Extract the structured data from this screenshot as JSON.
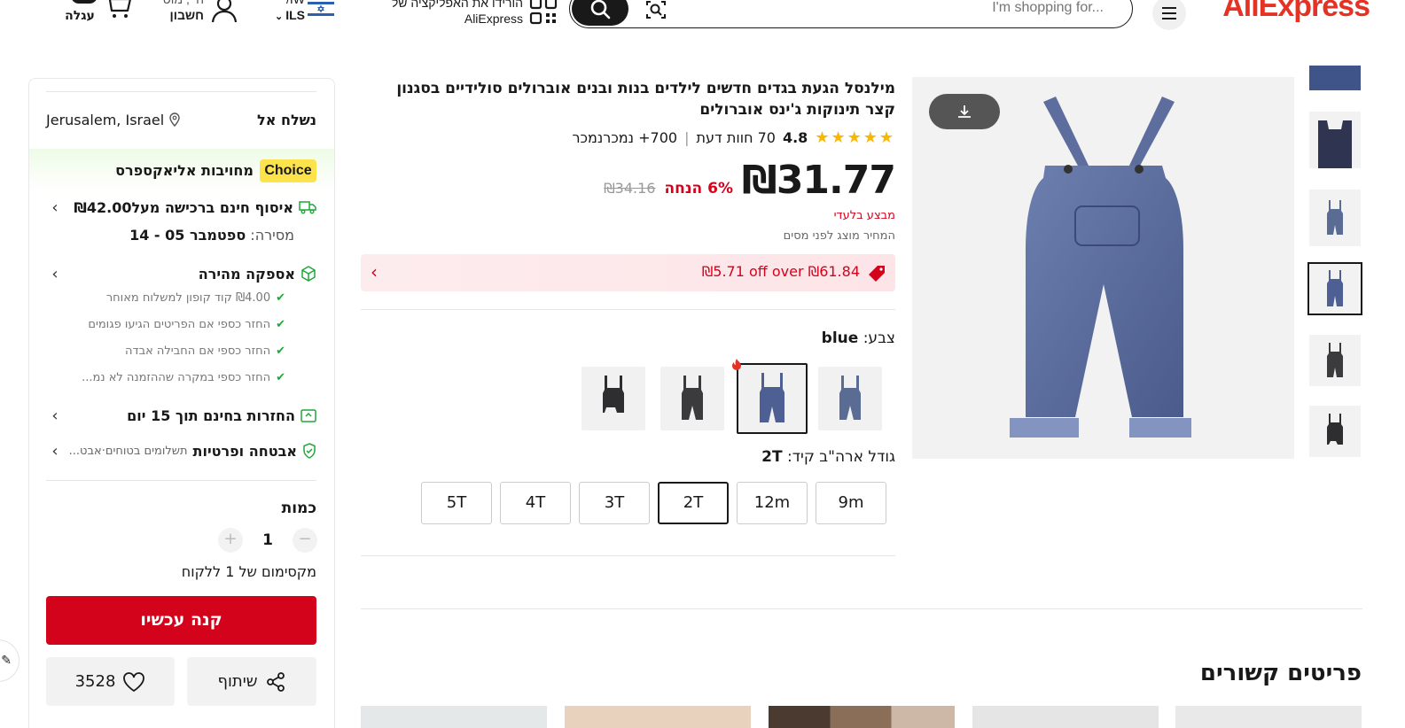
{
  "header": {
    "logo": "AliExpress",
    "search_placeholder": "I'm shopping for...",
    "app_line1": "הורידו את האפליקציה של",
    "app_line2": "AliExpress",
    "lang_line1": "/IW",
    "currency": "ILS",
    "account_line1": "היי, מוט",
    "account_line2": "חשבון",
    "cart_label": "עגלה"
  },
  "left_panel": {
    "ship_to_label": "נשלח אל",
    "location": "Jerusalem, Israel",
    "choice_badge": "Choice",
    "choice_text": "מחויבות אליאקספרס",
    "free_shipping": "איסוף חינם ברכישה מעל₪42.00",
    "delivery_label": "מסירה:",
    "delivery_dates": "ספטמבר 05 - 14",
    "fast_delivery": "אספקה מהירה",
    "checks": [
      "₪4.00 קוד קופון למשלוח מאוחר",
      "החזר כספי אם הפריטים הגיעו פגומים",
      "החזר כספי אם החבילה אבדה",
      "החזר כספי במקרה שההזמנה לא נמ..."
    ],
    "returns": "החזרות בחינם תוך 15 יום",
    "security_bold": "אבטחה ופרטיות",
    "security_rest": "תשלומים בטוחים·אבט...",
    "qty_title": "כמות",
    "qty_value": "1",
    "max_note": "מקסימום של 1 ללקוח",
    "buy_now": "קנה עכשיו",
    "share": "שיתוף",
    "wishlist_count": "3528"
  },
  "product": {
    "title": "מילנסל הגעת בגדים חדשים לילדים בנות ובנים אוברולים סולידיים בסגנון קצר תינוקות ג'ינס אוברולים",
    "rating": "4.8",
    "reviews": "70 חוות דעת",
    "sold": "700+ נמכרנמכר",
    "price": "₪31.77",
    "discount": "6% הנחה",
    "old_price": "₪34.16",
    "tax_note": "מבצע בלעדי",
    "tax_note2": "המחיר מוצג לפני מסים",
    "coupon": "₪5.71 off over ₪61.84",
    "color_label": "צבע:",
    "color_value": "blue",
    "size_label": "גודל ארה\"ב קיד:",
    "size_value": "2T",
    "sizes": [
      "9m",
      "12m",
      "2T",
      "3T",
      "4T",
      "5T"
    ],
    "selected_size": "2T"
  },
  "related": {
    "title": "פריטים קשורים"
  },
  "colors": {
    "brand_red": "#d3031c",
    "choice_yellow": "#fde34b",
    "star": "#fdb600",
    "check_green": "#1ea838"
  }
}
